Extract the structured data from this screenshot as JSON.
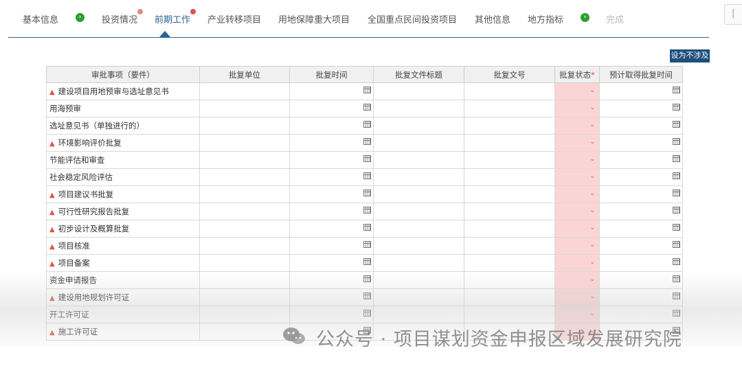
{
  "tabs": [
    {
      "label": "基本信息",
      "state": "normal"
    },
    {
      "label": "投资情况",
      "state": "normal"
    },
    {
      "label": "前期工作",
      "state": "active"
    },
    {
      "label": "产业转移项目",
      "state": "normal"
    },
    {
      "label": "用地保障重大项目",
      "state": "normal"
    },
    {
      "label": "全国重点民间投资项目",
      "state": "normal"
    },
    {
      "label": "其他信息",
      "state": "normal"
    },
    {
      "label": "地方指标",
      "state": "normal"
    },
    {
      "label": "完成",
      "state": "disabled"
    }
  ],
  "toolbar": {
    "not_applicable_label": "设为不涉及"
  },
  "table": {
    "columns": [
      "审批事项（要件）",
      "批复单位",
      "批复时间",
      "批复文件标题",
      "批复文号",
      "批复状态",
      "预计取得批复时间"
    ],
    "required_mark": "*",
    "rows": [
      {
        "name": "建设项目用地预审与选址意见书",
        "required": true
      },
      {
        "name": "用海预审",
        "required": false
      },
      {
        "name": "选址意见书（单独进行的）",
        "required": false
      },
      {
        "name": "环境影响评价批复",
        "required": true
      },
      {
        "name": "节能评估和审查",
        "required": false
      },
      {
        "name": "社会稳定风险评估",
        "required": false
      },
      {
        "name": "项目建议书批复",
        "required": true
      },
      {
        "name": "可行性研究报告批复",
        "required": true
      },
      {
        "name": "初步设计及概算批复",
        "required": true
      },
      {
        "name": "项目核准",
        "required": true
      },
      {
        "name": "项目备案",
        "required": true
      },
      {
        "name": "资金申请报告",
        "required": false
      },
      {
        "name": "建设用地规划许可证",
        "required": true
      },
      {
        "name": "开工许可证",
        "required": false
      },
      {
        "name": "施工许可证",
        "required": true
      }
    ]
  },
  "watermark": {
    "text": "公众号 · 项目谋划资金申报区域发展研究院"
  },
  "colors": {
    "accent": "#2a6592",
    "required": "#d9534f",
    "status_bg": "#fbd4d4",
    "button": "#1d4f7d"
  },
  "icons": {
    "tab_next": "arrow-right-circle-icon",
    "date": "calendar-icon",
    "status": "chevron-down-icon"
  }
}
